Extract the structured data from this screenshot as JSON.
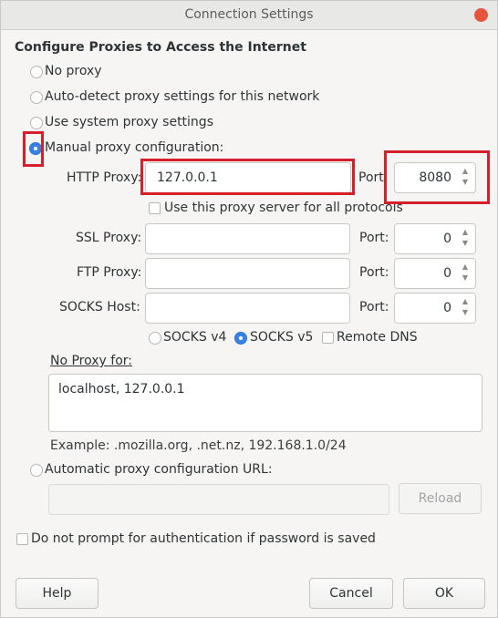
{
  "window": {
    "title": "Connection Settings"
  },
  "heading": "Configure Proxies to Access the Internet",
  "proxy_options": {
    "no_proxy": "No proxy",
    "auto_detect": "Auto-detect proxy settings for this network",
    "system": "Use system proxy settings",
    "manual": "Manual proxy configuration:",
    "selected": "manual"
  },
  "manual": {
    "http_label": "HTTP Proxy:",
    "http_value": "127.0.0.1",
    "http_port_label": "Port",
    "http_port_value": "8080",
    "use_for_all_label": "Use this proxy server for all protocols",
    "ssl_label": "SSL Proxy:",
    "ssl_value": "",
    "ssl_port_label": "Port:",
    "ssl_port_value": "0",
    "ftp_label": "FTP Proxy:",
    "ftp_value": "",
    "ftp_port_label": "Port:",
    "ftp_port_value": "0",
    "socks_label": "SOCKS Host:",
    "socks_value": "",
    "socks_port_label": "Port:",
    "socks_port_value": "0",
    "socks_v4": "SOCKS v4",
    "socks_v5": "SOCKS v5",
    "socks_selected": "v5",
    "remote_dns": "Remote DNS"
  },
  "no_proxy": {
    "label": "No Proxy for:",
    "value": "localhost, 127.0.0.1",
    "example": "Example: .mozilla.org, .net.nz, 192.168.1.0/24"
  },
  "auto_config": {
    "label": "Automatic proxy configuration URL:",
    "url_value": "",
    "reload_label": "Reload"
  },
  "auth_prompt_label": "Do not prompt for authentication if password is saved",
  "buttons": {
    "help": "Help",
    "cancel": "Cancel",
    "ok": "OK"
  },
  "colors": {
    "accent": "#3584e4",
    "highlight": "#d61f2c",
    "close": "#e8553e"
  }
}
